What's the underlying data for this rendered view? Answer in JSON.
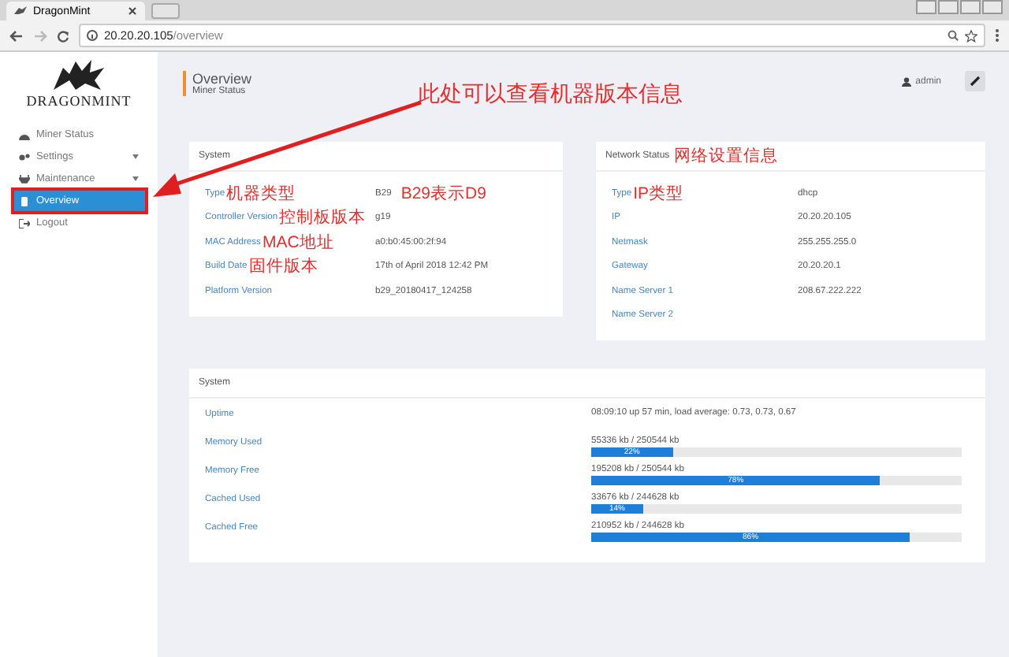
{
  "browser": {
    "tab_title": "DragonMint",
    "url_host": "20.20.20.105",
    "url_path": "/overview"
  },
  "sidebar": {
    "logo": "DRAGONMINT",
    "items": [
      {
        "label": "Miner Status",
        "kind": "dashboard",
        "expandable": false,
        "selected": false,
        "highlighted": false
      },
      {
        "label": "Settings",
        "kind": "gears",
        "expandable": true,
        "selected": false,
        "highlighted": false
      },
      {
        "label": "Maintenance",
        "kind": "plug",
        "expandable": true,
        "selected": false,
        "highlighted": false
      },
      {
        "label": "Overview",
        "kind": "page",
        "expandable": false,
        "selected": true,
        "highlighted": true
      },
      {
        "label": "Logout",
        "kind": "exit",
        "expandable": false,
        "selected": false,
        "highlighted": false
      }
    ]
  },
  "header": {
    "title": "Overview",
    "subtitle": "Miner Status",
    "user": "admin"
  },
  "callout": "此处可以查看机器版本信息",
  "version_card": {
    "title": "System",
    "rows": [
      {
        "label": "Type",
        "note": "机器类型",
        "value": "B29",
        "value_note": "B29表示D9"
      },
      {
        "label": "Controller Version",
        "note": "控制板版本",
        "value": "g19"
      },
      {
        "label": "MAC Address",
        "note": "MAC地址",
        "value": "a0:b0:45:00:2f:94"
      },
      {
        "label": "Build Date",
        "note": "固件版本",
        "value": "17th of April 2018 12:42 PM"
      },
      {
        "label": "Platform Version",
        "value": "b29_20180417_124258"
      }
    ]
  },
  "network_card": {
    "title": "Network Status",
    "title_note": "网络设置信息",
    "rows": [
      {
        "label": "Type",
        "note": "IP类型",
        "value": "dhcp"
      },
      {
        "label": "IP",
        "value": "20.20.20.105"
      },
      {
        "label": "Netmask",
        "value": "255.255.255.0"
      },
      {
        "label": "Gateway",
        "value": "20.20.20.1"
      },
      {
        "label": "Name Server 1",
        "value": "208.67.222.222"
      },
      {
        "label": "Name Server 2"
      }
    ]
  },
  "system_card": {
    "title": "System",
    "rows": [
      {
        "label": "Uptime",
        "reading": "08:09:10 up 57 min, load average: 0.73, 0.73, 0.67"
      },
      {
        "label": "Memory Used",
        "reading": "55336 kb / 250544 kb",
        "level": 0.22,
        "percent": "22%"
      },
      {
        "label": "Memory Free",
        "reading": "195208 kb / 250544 kb",
        "level": 0.78,
        "percent": "78%"
      },
      {
        "label": "Cached Used",
        "reading": "33676 kb / 244628 kb",
        "level": 0.14,
        "percent": "14%"
      },
      {
        "label": "Cached Free",
        "reading": "210952 kb / 244628 kb",
        "level": 0.86,
        "percent": "86%"
      }
    ]
  }
}
